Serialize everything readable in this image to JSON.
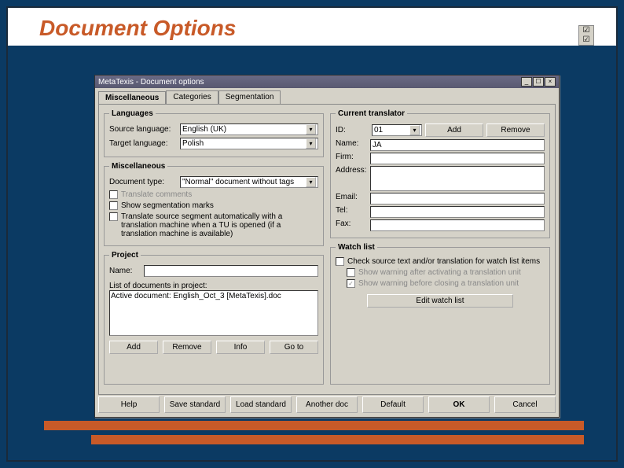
{
  "slide": {
    "title": "Document Options"
  },
  "dialog": {
    "window_title": "MetaTexis - Document options",
    "tabs": {
      "miscellaneous": "Miscellaneous",
      "categories": "Categories",
      "segmentation": "Segmentation"
    },
    "languages": {
      "legend": "Languages",
      "source_label": "Source language:",
      "source_value": "English (UK)",
      "target_label": "Target language:",
      "target_value": "Polish"
    },
    "misc": {
      "legend": "Miscellaneous",
      "doctype_label": "Document type:",
      "doctype_value": "\"Normal\" document without tags",
      "translate_comments": "Translate comments",
      "show_segmentation": "Show segmentation marks",
      "translate_auto": "Translate source segment automatically with a translation machine when a TU is opened (if a translation machine is available)"
    },
    "project": {
      "legend": "Project",
      "name_label": "Name:",
      "name_value": "",
      "list_label": "List of documents in project:",
      "item0": "Active document: English_Oct_3 [MetaTexis].doc",
      "add": "Add",
      "remove": "Remove",
      "info": "Info",
      "goto": "Go to"
    },
    "translator": {
      "legend": "Current translator",
      "id_label": "ID:",
      "id_value": "01",
      "add": "Add",
      "remove": "Remove",
      "name_label": "Name:",
      "name_value": "JA",
      "firm_label": "Firm:",
      "firm_value": "",
      "address_label": "Address:",
      "address_value": "",
      "email_label": "Email:",
      "email_value": "",
      "tel_label": "Tel:",
      "tel_value": "",
      "fax_label": "Fax:",
      "fax_value": ""
    },
    "watchlist": {
      "legend": "Watch list",
      "check_source": "Check source text and/or translation for watch list items",
      "warn_after": "Show warning after activating a translation unit",
      "warn_before": "Show warning before closing a translation unit",
      "edit_btn": "Edit watch list"
    },
    "footer": {
      "help": "Help",
      "save_std": "Save standard",
      "load_std": "Load standard",
      "another": "Another doc",
      "default": "Default",
      "ok": "OK",
      "cancel": "Cancel"
    }
  },
  "icons": {
    "check": "☑"
  }
}
